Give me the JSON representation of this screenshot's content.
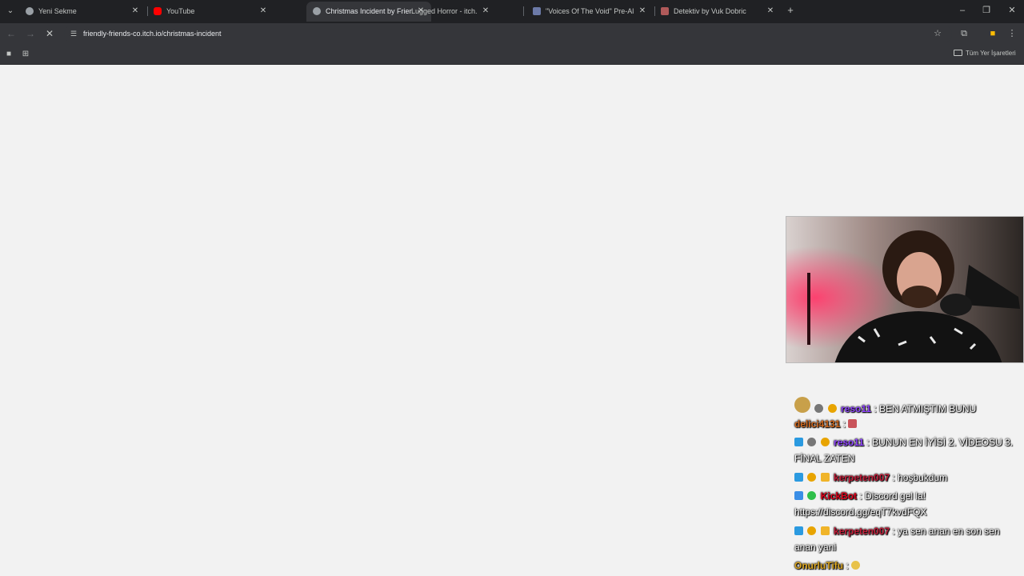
{
  "tabs": [
    {
      "title": "Yeni Sekme",
      "favicon_color": "#9aa0a6"
    },
    {
      "title": "YouTube",
      "favicon_color": "#ff0000"
    },
    {
      "title": "Christmas Incident by Friendly Friends",
      "favicon_color": "#9aa0a6"
    },
    {
      "title": "Lugged Horror - itch.io",
      "favicon_color": "#fa5c5c"
    },
    {
      "title": "\"Voices Of The Void\" Pre-Alpha",
      "favicon_color": "#6c7aa8"
    },
    {
      "title": "Detektiv by Vuk Dobric",
      "favicon_color": "#b05a5a"
    }
  ],
  "address_bar": {
    "url": "friendly-friends-co.itch.io/christmas-incident"
  },
  "bookmarks": {
    "all_bookmarks_label": "Tüm Yer İşaretleri"
  },
  "chat": [
    {
      "user": "reso11",
      "user_color": "#9146ff",
      "text": ": BEN ATMIŞTIM BUNU"
    },
    {
      "user": "delici4131",
      "user_color": "#d2691e",
      "text": ":"
    },
    {
      "user": "reso11",
      "user_color": "#9146ff",
      "text": ": BUNUN EN İYİSİ 2. VİDEOSU 3. FİNAL ZATEN"
    },
    {
      "user": "kerpeten007",
      "user_color": "#c41e3a",
      "text": ": hoşbukdum"
    },
    {
      "user": "KickBot",
      "user_color": "#e0001b",
      "text": ": Discord gel la! https://discord.gg/eqT7kvdFQX"
    },
    {
      "user": "kerpeten007",
      "user_color": "#c41e3a",
      "text": ": ya sen anan en son sen anan yani"
    },
    {
      "user": "OnurluTifu",
      "user_color": "#daa520",
      "text": ":"
    }
  ],
  "colors": {
    "tabstrip": "#202124",
    "toolbar": "#35363a",
    "page": "#f2f2f2"
  }
}
